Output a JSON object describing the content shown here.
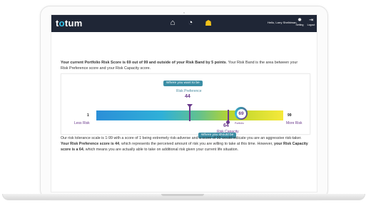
{
  "brand": {
    "logo_prefix": "t",
    "logo_dot": "o",
    "logo_suffix": "tum"
  },
  "nav": {
    "icons": [
      "home-icon",
      "dashboard-icon",
      "people-icon"
    ],
    "greeting": "Hello, Larry Shelbiman",
    "setting_label": "Setting",
    "logout_label": "Logout"
  },
  "summary": {
    "part1": "Your current Portfolio Risk Score is 69 out of 99 and outside of your Risk Band by 5 points",
    "part2": ". Your Risk Band is the area between your Risk Preference score and your Risk Capacity score."
  },
  "gauge": {
    "want_label": "Where you want to be",
    "pref_label": "Risk Preference",
    "pref_value": "44",
    "min_value": "1",
    "max_value": "99",
    "less_label": "Less Risk",
    "more_label": "More Risk",
    "capacity_value": "64",
    "capacity_label": "Risk Capacity",
    "should_label": "Where you should be",
    "portfolio_score": "69",
    "portfolio_label": "Portfolio"
  },
  "explain": {
    "t1": "Our risk tolerance scale is 1-99 with a score of 1 being extremely risk-adverse and a score of 99 would indicate you are an aggressive risk-taker. ",
    "b1": "Your Risk Preference score is 44",
    "t2": ", which represents the perceived amount of risk you are willing to take at this time. However, ",
    "b2": "your Risk Capacity score is a 64",
    "t3": ", which means you are actually able to take on additional risk given your current life situation."
  },
  "colors": {
    "navbar": "#1f2636",
    "accent": "#3b8ea5",
    "purple": "#6b3a8c"
  }
}
